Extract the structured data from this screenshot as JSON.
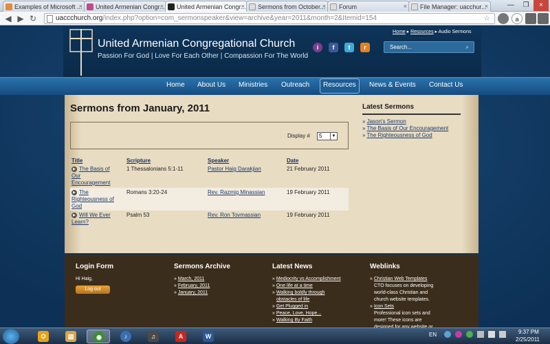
{
  "browser": {
    "tabs": [
      {
        "title": "Examples of Microsoft ...",
        "color": "#e6893a"
      },
      {
        "title": "United Armenian Congr...",
        "color": "#c14a8c"
      },
      {
        "title": "United Armenian Congr...",
        "color": "#222222"
      },
      {
        "title": "Sermons from October...",
        "color": "#cccccc"
      },
      {
        "title": "Forum",
        "color": "#cccccc"
      },
      {
        "title": "File Manager: uacchur...",
        "color": "#cccccc"
      }
    ],
    "address_host": "uaccchurch.org",
    "address_path": "/index.php?option=com_sermonspeaker&view=archive&year=2011&month=2&Itemid=154",
    "close_glyph": "×",
    "back_glyph": "◀",
    "forward_glyph": "▶",
    "reload_glyph": "↻",
    "star_glyph": "☆",
    "minimize_glyph": "—",
    "maximize_glyph": "❐"
  },
  "site": {
    "title": "United Armenian Congregational Church",
    "tagline": "Passion For God | Love For Each Other | Compassion For The World",
    "breadcrumb": {
      "home": "Home",
      "resources": "Resources",
      "current": "Audio Sermons",
      "sep": "▸"
    },
    "search_placeholder": "Search...",
    "nav": [
      "Home",
      "About Us",
      "Ministries",
      "Outreach",
      "Resources",
      "News & Events",
      "Contact Us"
    ],
    "page_title": "Sermons from January, 2011",
    "display_label": "Display #",
    "display_value": "5",
    "columns": {
      "title": "Title",
      "scripture": "Scripture",
      "speaker": "Speaker",
      "date": "Date"
    },
    "sermons": [
      {
        "title_l1": "The Basis of",
        "title_l2": "Our",
        "title_l3": "Encouragement",
        "scripture": "1 Thessalonians 5:1-11",
        "speaker": "Pastor Haig Darakjian",
        "date": "21 February 2011"
      },
      {
        "title_l1": "The",
        "title_l2": "Righteousness of",
        "title_l3": "God",
        "scripture": "Romans 3:20-24",
        "speaker": "Rev. Razmig Minassian",
        "date": "19 February 2011"
      },
      {
        "title_l1": "Will We Ever",
        "title_l2": "Learn?",
        "title_l3": "",
        "scripture": "Psalm 53",
        "speaker": "Rev. Ron Tovmassian",
        "date": "19 February 2011"
      }
    ],
    "latest_title": "Latest Sermons",
    "latest": [
      "Jason's Sermon",
      "The Basis of Our Encouragement",
      "The Righteousness of God"
    ],
    "footer": {
      "login_title": "Login Form",
      "greeting": "Hi Haig,",
      "logout": "Log out",
      "archive_title": "Sermons Archive",
      "archive": [
        "March, 2011",
        "February, 2011",
        "January, 2011"
      ],
      "news_title": "Latest News",
      "news": [
        "Mediocrity vs Accomplishment",
        "One life at a time",
        "Walking boldly through",
        "obstacles of life",
        "Get Plugged in",
        "Peace, Love, Hope...",
        "Walking By Faith"
      ],
      "weblinks_title": "Weblinks",
      "weblink1": "Christian Web Templates",
      "weblink1_desc1": "CTO focuses on developing",
      "weblink1_desc2": "world-class Christian and",
      "weblink1_desc3": "church website templates.",
      "weblink2": "Icon Sets",
      "weblink2_desc1": "Professional icon sets and",
      "weblink2_desc2": "more!  These icons are",
      "weblink2_desc3": "designed for any website or"
    },
    "bullet": "»",
    "play_glyph": "▶",
    "search_glyph": "⌕"
  },
  "taskbar": {
    "language": "EN",
    "time": "9:37 PM",
    "date": "2/25/2011",
    "apps": [
      {
        "name": "outlook",
        "glyph": "O",
        "color": "#e8a317"
      },
      {
        "name": "explorer",
        "glyph": "▤",
        "color": "#d9a441"
      },
      {
        "name": "chrome",
        "glyph": "◉",
        "color": "#3c8d2f"
      },
      {
        "name": "itunes",
        "glyph": "♪",
        "color": "#3a6fb0"
      },
      {
        "name": "itunes-alt",
        "glyph": "♫",
        "color": "#4a4a4a"
      },
      {
        "name": "acrobat",
        "glyph": "A",
        "color": "#c8261d"
      },
      {
        "name": "word",
        "glyph": "W",
        "color": "#2b5797"
      }
    ]
  }
}
